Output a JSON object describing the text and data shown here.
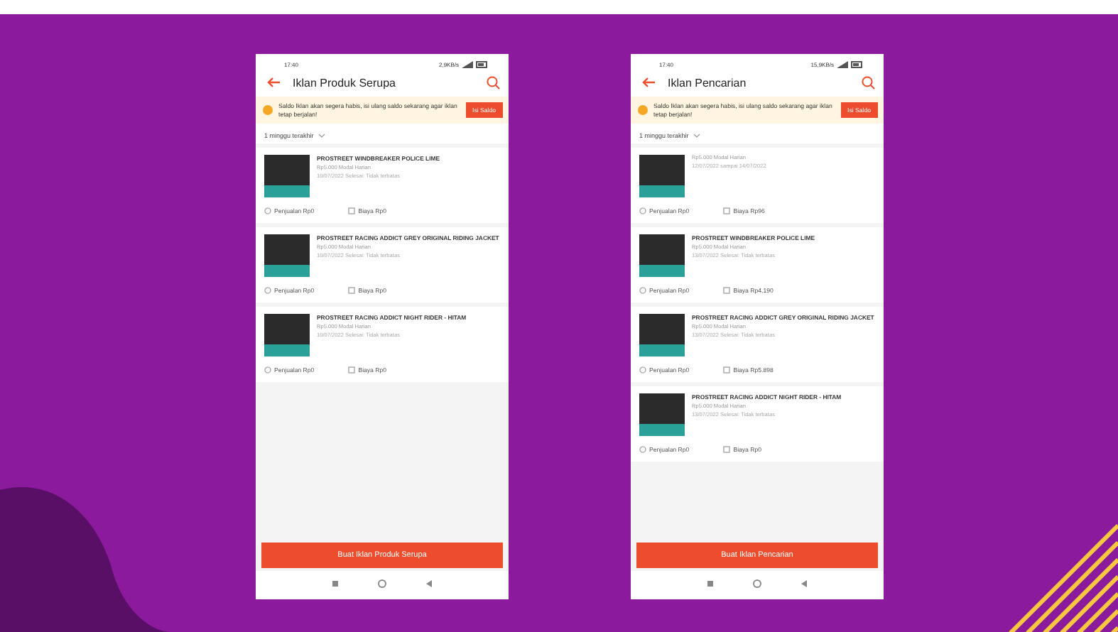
{
  "phones": [
    {
      "status_bar": {
        "time": "17:40",
        "speed": "2,9KB/s"
      },
      "title": "Iklan Produk Serupa",
      "banner": {
        "text": "Saldo Iklan akan segera habis, isi ulang saldo sekarang agar iklan tetap berjalan!",
        "button": "Isi Saldo"
      },
      "filter": "1 minggu terakhir",
      "items": [
        {
          "title": "PROSTREET WINDBREAKER POLICE LIME",
          "meta": [
            "Rp5.000 Modal Harian",
            "10/07/2022 Selesai: Tidak terbatas"
          ],
          "sales": "Penjualan Rp0",
          "cost": "Biaya Rp0"
        },
        {
          "title": "PROSTREET RACING ADDICT GREY ORIGINAL RIDING JACKET",
          "meta": [
            "Rp5.000 Modal Harian",
            "10/07/2022 Selesai: Tidak terbatas"
          ],
          "sales": "Penjualan Rp0",
          "cost": "Biaya Rp0"
        },
        {
          "title": "PROSTREET RACING ADDICT NIGHT RIDER - HITAM",
          "meta": [
            "Rp5.000 Modal Harian",
            "10/07/2022 Selesai: Tidak terbatas"
          ],
          "sales": "Penjualan Rp0",
          "cost": "Biaya Rp0"
        }
      ],
      "action": "Buat Iklan Produk Serupa"
    },
    {
      "status_bar": {
        "time": "17:40",
        "speed": "15,9KB/s"
      },
      "title": "Iklan Pencarian",
      "banner": {
        "text": "Saldo Iklan akan segera habis, isi ulang saldo sekarang agar iklan tetap berjalan!",
        "button": "Isi Saldo"
      },
      "filter": "1 minggu terakhir",
      "items": [
        {
          "meta": [
            "Rp5.000 Modal Harian",
            "12/07/2022 sampai 14/07/2022"
          ],
          "sales": "Penjualan Rp0",
          "cost": "Biaya Rp96"
        },
        {
          "title": "PROSTREET WINDBREAKER POLICE LIME",
          "meta": [
            "Rp5.000 Modal Harian",
            "13/07/2022 Selesai: Tidak terbatas"
          ],
          "sales": "Penjualan Rp0",
          "cost": "Biaya Rp4.190"
        },
        {
          "title": "PROSTREET RACING ADDICT GREY ORIGINAL RIDING JACKET",
          "meta": [
            "Rp5.000 Modal Harian",
            "13/07/2022 Selesai: Tidak terbatas"
          ],
          "sales": "Penjualan Rp0",
          "cost": "Biaya Rp5.898"
        },
        {
          "title": "PROSTREET RACING ADDICT NIGHT RIDER - HITAM",
          "meta": [
            "Rp5.000 Modal Harian",
            "13/07/2022 Selesai: Tidak terbatas"
          ],
          "sales": "Penjualan Rp0",
          "cost": "Biaya Rp0"
        }
      ],
      "action": "Buat Iklan Pencarian"
    }
  ]
}
